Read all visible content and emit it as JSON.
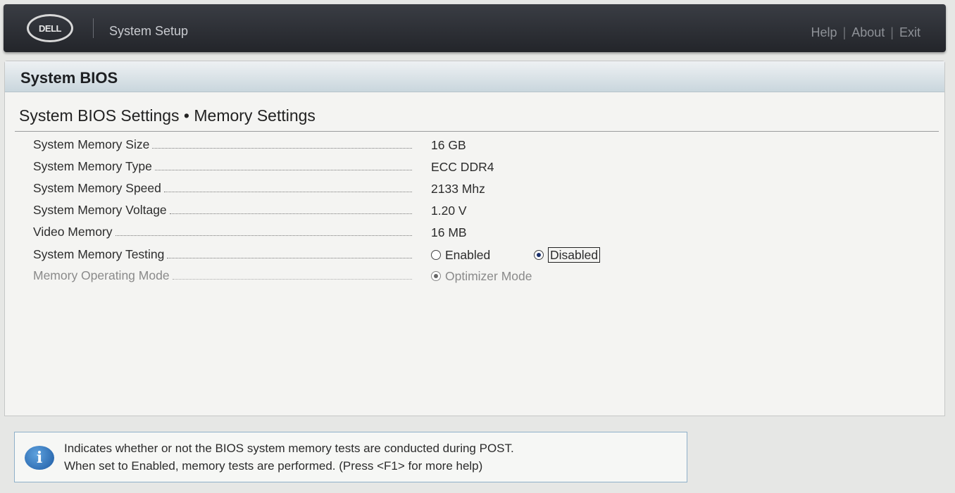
{
  "header": {
    "logo_text": "DELL",
    "app_title": "System Setup",
    "nav": {
      "help": "Help",
      "about": "About",
      "exit": "Exit"
    },
    "separator": "|"
  },
  "panel": {
    "title": "System BIOS",
    "breadcrumb": "System BIOS Settings • Memory Settings"
  },
  "settings": {
    "memory_size": {
      "label": "System Memory Size",
      "value": "16 GB"
    },
    "memory_type": {
      "label": "System Memory Type",
      "value": "ECC DDR4"
    },
    "memory_speed": {
      "label": "System Memory Speed",
      "value": "2133 Mhz"
    },
    "memory_voltage": {
      "label": "System Memory Voltage",
      "value": "1.20 V"
    },
    "video_memory": {
      "label": "Video Memory",
      "value": "16 MB"
    },
    "memory_testing": {
      "label": "System Memory Testing",
      "options": [
        "Enabled",
        "Disabled"
      ],
      "selected": "Disabled"
    },
    "operating_mode": {
      "label": "Memory Operating Mode",
      "options": [
        "Optimizer Mode"
      ],
      "selected": "Optimizer Mode"
    }
  },
  "help": {
    "line1": "Indicates whether or not the BIOS system memory tests are conducted during POST.",
    "line2": "When set to Enabled, memory tests are performed. (Press <F1> for more help)"
  },
  "colors": {
    "accent": "#1a2f6b",
    "header_bg": "#2b2e34",
    "info_blue": "#1d5aa3"
  }
}
